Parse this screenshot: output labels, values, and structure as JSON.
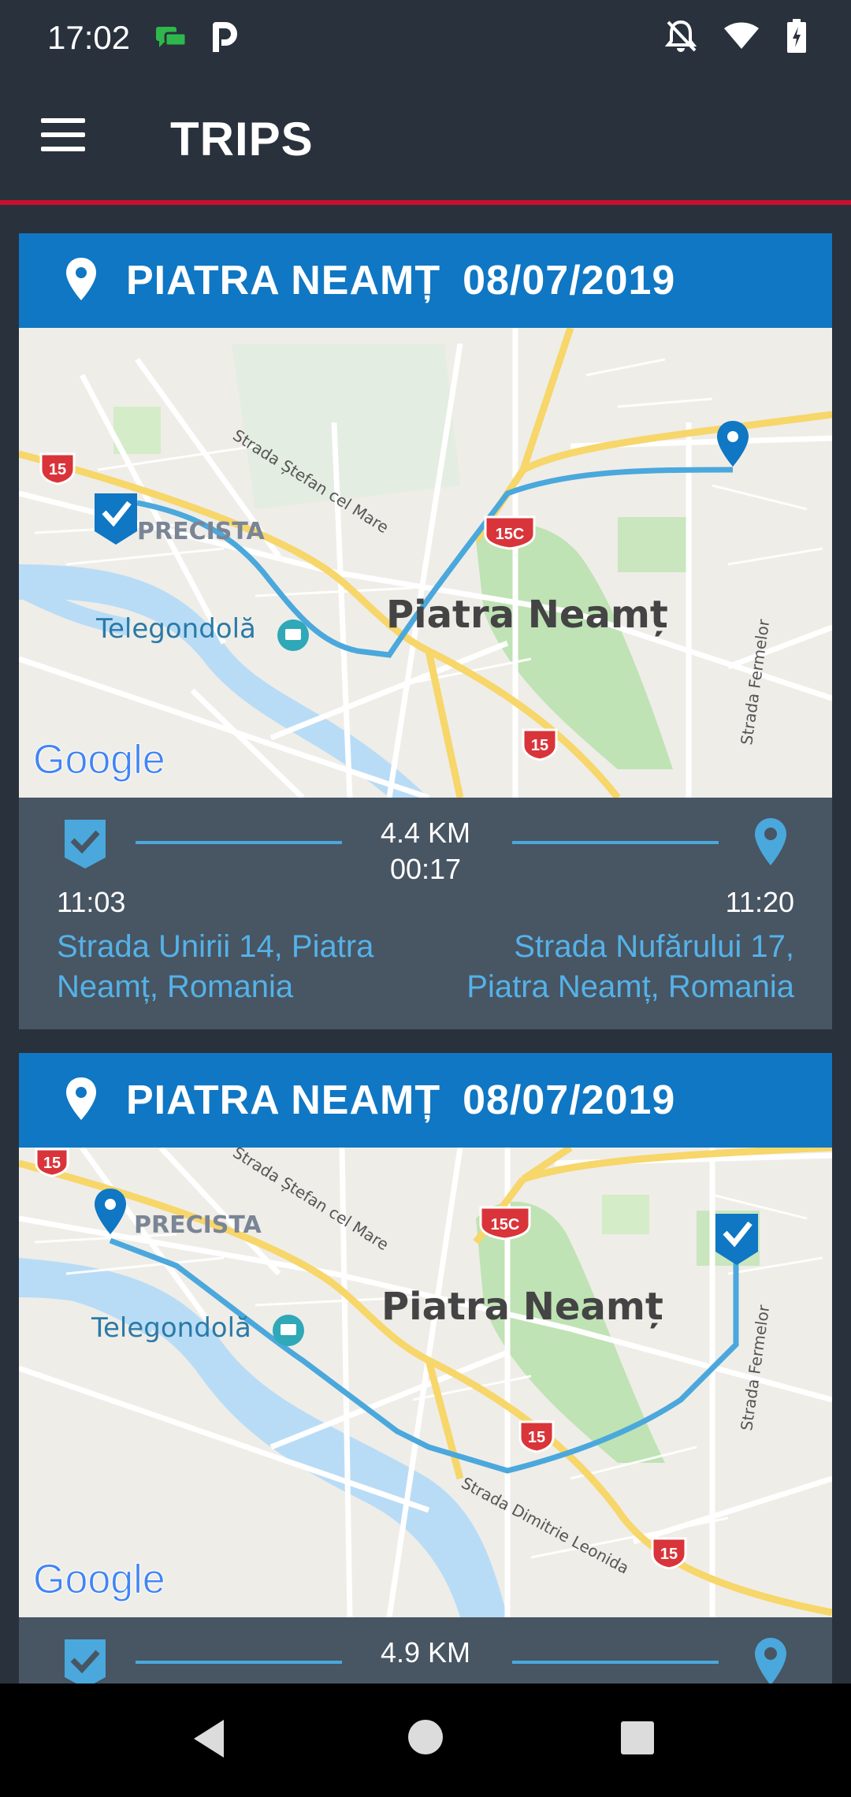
{
  "status_bar": {
    "time": "17:02",
    "left_icons": [
      "chat-icon",
      "parking-icon"
    ],
    "right_icons": [
      "notifications-off-icon",
      "wifi-icon",
      "battery-charging-icon"
    ]
  },
  "app_bar": {
    "menu_icon": "hamburger-menu-icon",
    "title": "TRIPS",
    "accent_color": "#c8102e"
  },
  "colors": {
    "background": "#29313d",
    "card_header": "#0f77c3",
    "card_info": "#485563",
    "route": "#4aa8dc",
    "address_text": "#54b2e8"
  },
  "trips": [
    {
      "city": "PIATRA NEAMȚ",
      "date": "08/07/2019",
      "map": {
        "city_label": "Piatra Neamț",
        "district_label": "PRECISTA",
        "poi_label": "Telegondolă",
        "streets": [
          "Strada Ștefan cel Mare",
          "Strada Fermelor"
        ],
        "road_shields": [
          "15",
          "15C",
          "15"
        ],
        "attribution": "Google"
      },
      "distance": "4.4 KM",
      "duration": "00:17",
      "start_time": "11:03",
      "end_time": "11:20",
      "start_address": "Strada Unirii 14, Piatra Neamț, Romania",
      "end_address": "Strada Nufărului 17, Piatra Neamț, Romania"
    },
    {
      "city": "PIATRA NEAMȚ",
      "date": "08/07/2019",
      "map": {
        "city_label": "Piatra Neamț",
        "district_label": "PRECISTA",
        "poi_label": "Telegondolă",
        "streets": [
          "Strada Ștefan cel Mare",
          "Strada Fermelor",
          "Strada Dimitrie Leonida"
        ],
        "road_shields": [
          "15",
          "15C",
          "15",
          "15"
        ],
        "attribution": "Google"
      },
      "distance": "4.9 KM"
    }
  ],
  "nav_bar": [
    "back-icon",
    "home-icon",
    "recents-icon"
  ]
}
